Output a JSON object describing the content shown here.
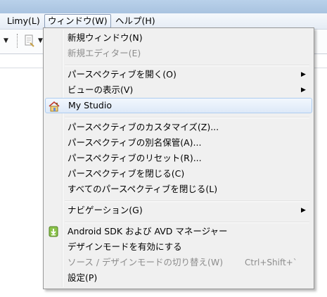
{
  "menubar": {
    "items": [
      {
        "label": "Limy(L)"
      },
      {
        "label": "ウィンドウ(W)"
      },
      {
        "label": "ヘルプ(H)"
      }
    ]
  },
  "menu": {
    "items": [
      {
        "label": "新規ウィンドウ(N)",
        "enabled": true
      },
      {
        "label": "新規エディター(E)",
        "enabled": false
      },
      {
        "label": "パースペクティブを開く(O)",
        "submenu": true
      },
      {
        "label": "ビューの表示(V)",
        "submenu": true
      },
      {
        "label": "My Studio",
        "icon": "home-icon",
        "highlighted": true
      },
      {
        "label": "パースペクティブのカスタマイズ(Z)..."
      },
      {
        "label": "パースペクティブの別名保管(A)..."
      },
      {
        "label": "パースペクティブのリセット(R)..."
      },
      {
        "label": "パースペクティブを閉じる(C)"
      },
      {
        "label": "すべてのパースペクティブを閉じる(L)"
      },
      {
        "label": "ナビゲーション(G)",
        "submenu": true
      },
      {
        "label": "Android SDK および AVD マネージャー",
        "icon": "android-download-icon"
      },
      {
        "label": "デザインモードを有効にする"
      },
      {
        "label": "ソース / デザインモードの切り替え(W)",
        "shortcut": "Ctrl+Shift+`",
        "enabled": false
      },
      {
        "label": "設定(P)"
      }
    ]
  },
  "colors": {
    "highlight_border": "#aecdf0",
    "disabled_text": "#8d8d8d",
    "menu_bg": "#f0f0f0"
  }
}
